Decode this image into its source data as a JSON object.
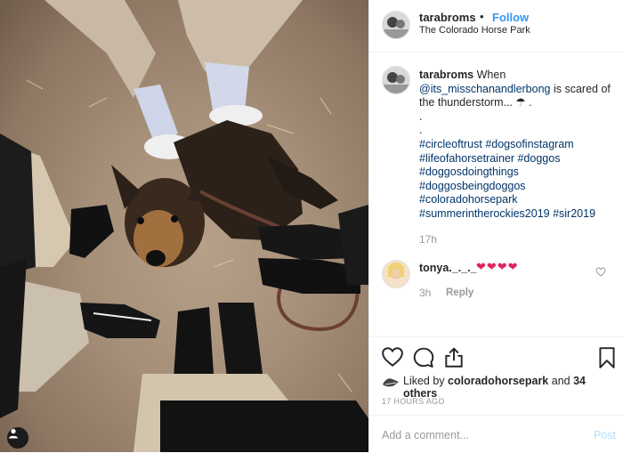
{
  "post": {
    "author": "tarabroms",
    "follow_separator": "•",
    "follow_label": "Follow",
    "location": "The Colorado Horse Park"
  },
  "caption": {
    "username": "tarabroms",
    "text_before": " When",
    "mention": "@its_misschanandlerbong",
    "text_after": " is scared of the thunderstorm... ☂ .",
    "dots": [
      ".",
      "."
    ],
    "hashtags": [
      "#circleoftrust #dogsofinstagram",
      "#lifeofahorsetrainer #doggos",
      "#doggosdoingthings",
      "#doggosbeingdoggos",
      "#coloradohorsepark",
      "#summerintherockies2019 #sir2019"
    ],
    "time": "17h"
  },
  "comment": {
    "username": "tonya._._._",
    "text": "❤❤❤❤",
    "time": "3h",
    "reply_label": "Reply"
  },
  "likes": {
    "prefix": "Liked by ",
    "user": "coloradohorsepark",
    "middle": " and ",
    "others": "34 others"
  },
  "timestamp": "17 HOURS AGO",
  "composer": {
    "placeholder": "Add a comment...",
    "post_label": "Post"
  },
  "icons": {
    "heart": "heart-icon",
    "comment": "comment-icon",
    "share": "share-icon",
    "save": "bookmark-icon",
    "user_tag": "user-tag-icon"
  },
  "colors": {
    "link": "#003569",
    "follow": "#3897f0",
    "muted": "#999999",
    "post_disabled": "#b2dffc"
  }
}
